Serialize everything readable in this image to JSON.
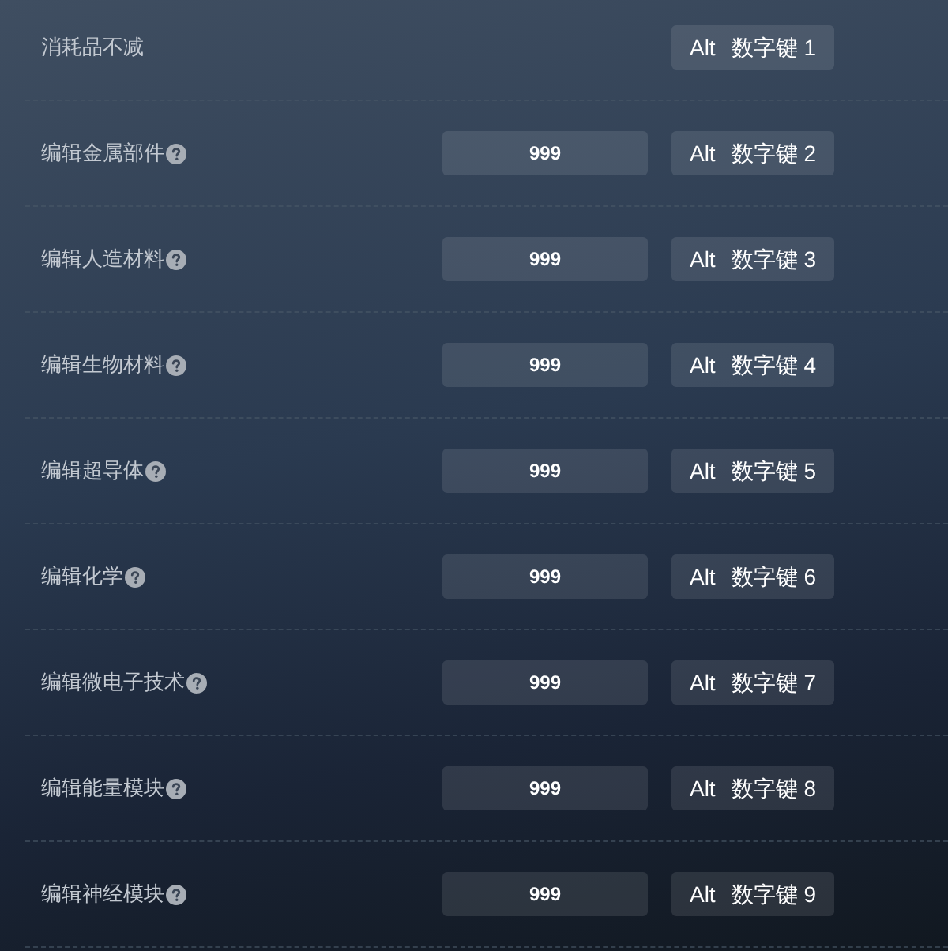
{
  "rows": [
    {
      "kind": "toggle",
      "label": "消耗品不减",
      "help": false,
      "hotkey": {
        "modifier": "Alt",
        "key": "数字键 1"
      }
    },
    {
      "kind": "value",
      "label": "编辑金属部件",
      "help": true,
      "value": "999",
      "hotkey": {
        "modifier": "Alt",
        "key": "数字键 2"
      }
    },
    {
      "kind": "value",
      "label": "编辑人造材料",
      "help": true,
      "value": "999",
      "hotkey": {
        "modifier": "Alt",
        "key": "数字键 3"
      }
    },
    {
      "kind": "value",
      "label": "编辑生物材料",
      "help": true,
      "value": "999",
      "hotkey": {
        "modifier": "Alt",
        "key": "数字键 4"
      }
    },
    {
      "kind": "value",
      "label": "编辑超导体",
      "help": true,
      "value": "999",
      "hotkey": {
        "modifier": "Alt",
        "key": "数字键 5"
      }
    },
    {
      "kind": "value",
      "label": "编辑化学",
      "help": true,
      "value": "999",
      "hotkey": {
        "modifier": "Alt",
        "key": "数字键 6"
      }
    },
    {
      "kind": "value",
      "label": "编辑微电子技术",
      "help": true,
      "value": "999",
      "hotkey": {
        "modifier": "Alt",
        "key": "数字键 7"
      }
    },
    {
      "kind": "value",
      "label": "编辑能量模块",
      "help": true,
      "value": "999",
      "hotkey": {
        "modifier": "Alt",
        "key": "数字键 8"
      }
    },
    {
      "kind": "value",
      "label": "编辑神经模块",
      "help": true,
      "value": "999",
      "hotkey": {
        "modifier": "Alt",
        "key": "数字键 9"
      }
    }
  ]
}
